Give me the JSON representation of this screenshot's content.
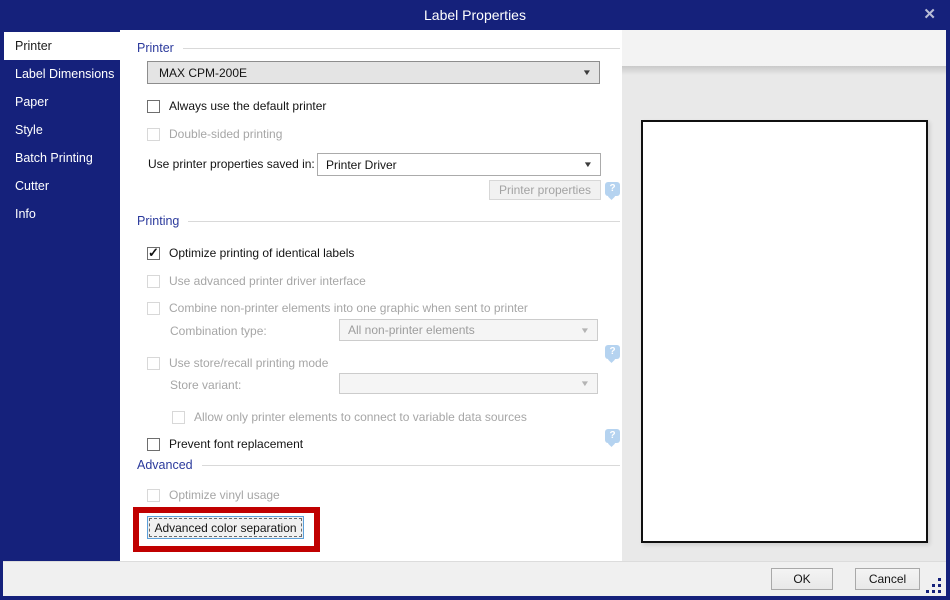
{
  "window": {
    "title": "Label Properties",
    "close_glyph": "✕"
  },
  "colors": {
    "accent_navy": "#15217b",
    "section_header_blue": "#2b3a9c",
    "annotation_red": "#c00000",
    "help_icon_blue": "#b5d3f0"
  },
  "sidebar": {
    "items": [
      {
        "label": "Printer",
        "selected": true
      },
      {
        "label": "Label Dimensions",
        "selected": false
      },
      {
        "label": "Paper",
        "selected": false
      },
      {
        "label": "Style",
        "selected": false
      },
      {
        "label": "Batch Printing",
        "selected": false
      },
      {
        "label": "Cutter",
        "selected": false
      },
      {
        "label": "Info",
        "selected": false
      }
    ]
  },
  "printer_section": {
    "header": "Printer",
    "printer_combo_value": "MAX CPM-200E",
    "always_default_label": "Always use the default printer",
    "always_default_checked": false,
    "double_sided_label": "Double-sided printing",
    "double_sided_checked": false,
    "properties_saved_label": "Use printer properties saved in:",
    "properties_saved_value": "Printer Driver",
    "printer_properties_button": "Printer properties"
  },
  "printing_section": {
    "header": "Printing",
    "optimize_identical_label": "Optimize printing of identical labels",
    "optimize_identical_checked": true,
    "advanced_driver_label": "Use advanced printer driver interface",
    "combine_label": "Combine non-printer elements into one graphic when sent to printer",
    "combination_type_label": "Combination type:",
    "combination_type_value": "All non-printer elements",
    "store_recall_label": "Use store/recall printing mode",
    "store_variant_label": "Store variant:",
    "store_variant_value": "",
    "allow_printer_elements_label": "Allow only printer elements to connect to variable data sources",
    "prevent_font_label": "Prevent font replacement",
    "prevent_font_checked": false
  },
  "advanced_section": {
    "header": "Advanced",
    "optimize_vinyl_label": "Optimize vinyl usage",
    "color_separation_button": "Advanced color separation"
  },
  "footer": {
    "ok_label": "OK",
    "cancel_label": "Cancel"
  },
  "icons": {
    "check": "✓",
    "dropdown_arrow": "▼",
    "help": "?"
  }
}
